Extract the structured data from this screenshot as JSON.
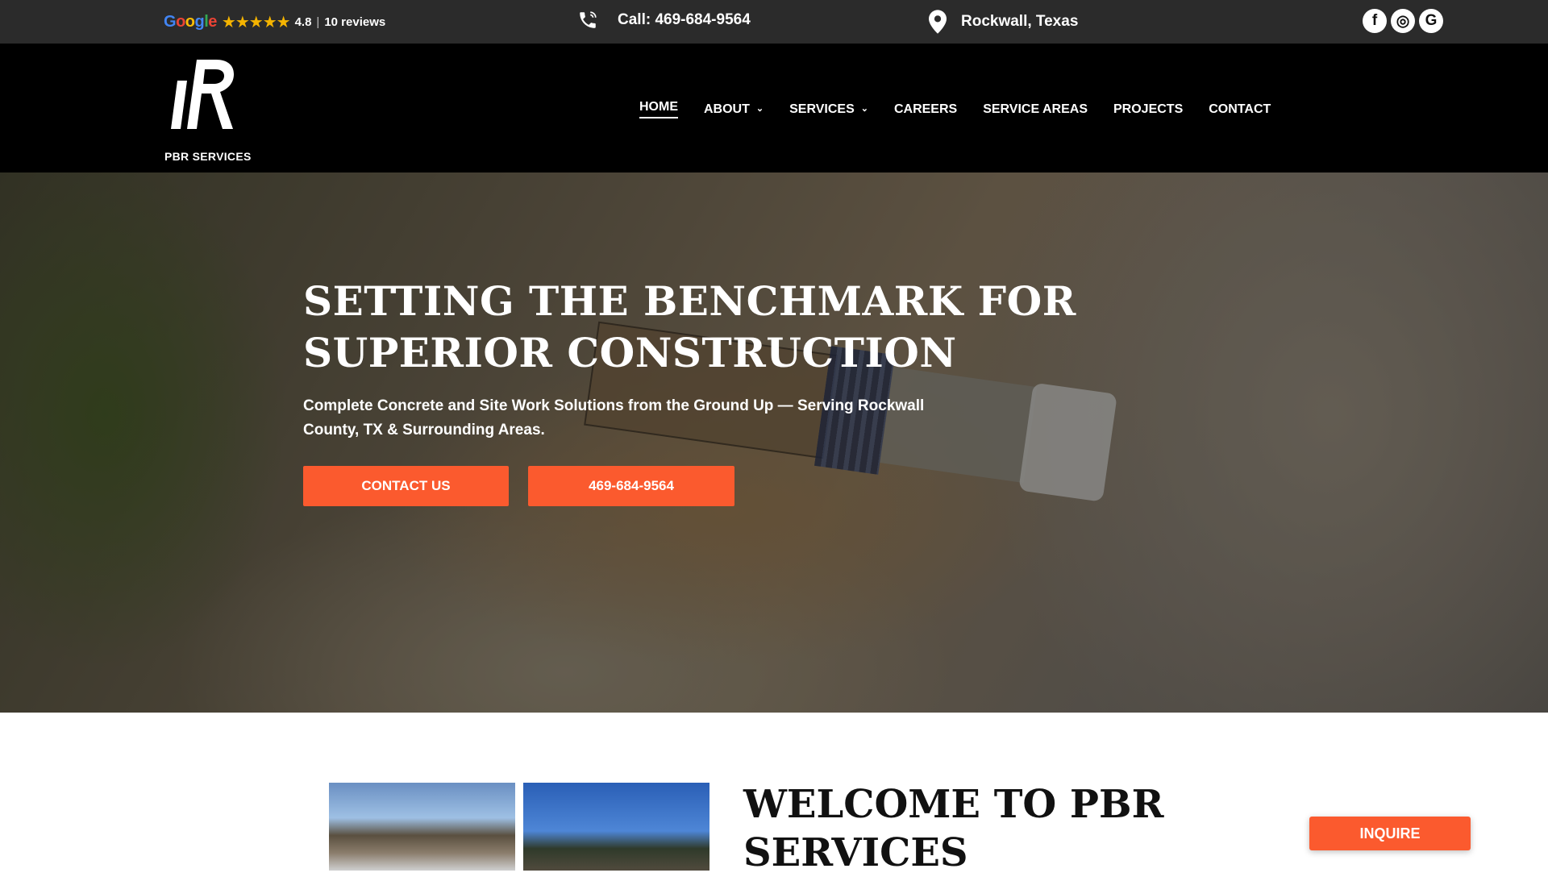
{
  "topbar": {
    "google_label": "Google",
    "stars": "★★★★★",
    "rating": "4.8",
    "separator": "|",
    "reviews": "10 reviews",
    "phone": "Call: 469-684-9564",
    "location": "Rockwall, Texas",
    "socials": [
      {
        "icon": "facebook-icon",
        "glyph": "f"
      },
      {
        "icon": "instagram-icon",
        "glyph": "◎"
      },
      {
        "icon": "google-icon",
        "glyph": "G"
      }
    ]
  },
  "header": {
    "logo_text": "PBR SERVICES",
    "nav": [
      {
        "label": "HOME",
        "active": true
      },
      {
        "label": "ABOUT",
        "dropdown": true
      },
      {
        "label": "SERVICES",
        "dropdown": true
      },
      {
        "label": "CAREERS"
      },
      {
        "label": "SERVICE AREAS"
      },
      {
        "label": "PROJECTS"
      },
      {
        "label": "CONTACT"
      }
    ]
  },
  "hero": {
    "title": "SETTING THE BENCHMARK FOR SUPERIOR CONSTRUCTION",
    "subtitle": "Complete Concrete and Site Work Solutions from the Ground Up — Serving Rockwall County, TX & Surrounding Areas.",
    "cta_contact": "CONTACT US",
    "cta_phone": "469-684-9564"
  },
  "welcome": {
    "title": "WELCOME TO PBR SERVICES"
  },
  "inquire_label": "INQUIRE",
  "colors": {
    "accent": "#fb5a2e",
    "topbar_bg": "#2b2b2b",
    "header_bg": "#000000",
    "star": "#f5b400"
  }
}
